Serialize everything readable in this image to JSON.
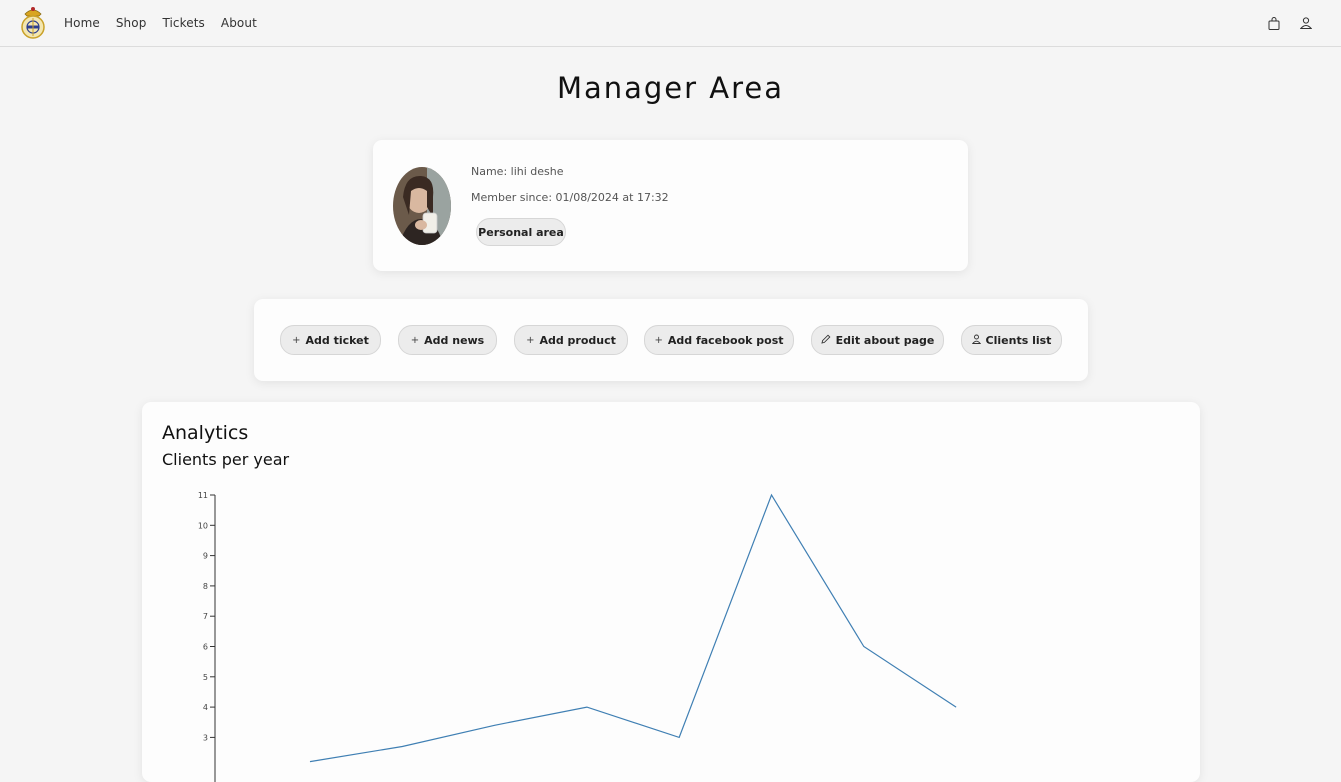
{
  "nav": {
    "links": [
      "Home",
      "Shop",
      "Tickets",
      "About"
    ],
    "icons": [
      "bag-icon",
      "user-icon"
    ],
    "logo": "club-crest-logo"
  },
  "page": {
    "title": "Manager Area"
  },
  "profile": {
    "name_line": "Name: lihi deshe",
    "member_since_line": "Member since: 01/08/2024 at 17:32",
    "personal_area_label": "Personal area"
  },
  "actions": [
    {
      "prefix": "+",
      "label": "Add ticket"
    },
    {
      "prefix": "+",
      "label": "Add news"
    },
    {
      "prefix": "+",
      "label": "Add product"
    },
    {
      "prefix": "+",
      "label": "Add facebook post"
    },
    {
      "prefix": "pencil-icon",
      "label": "Edit about page"
    },
    {
      "prefix": "user-icon",
      "label": "Clients list"
    }
  ],
  "analytics": {
    "title": "Analytics"
  },
  "colors": {
    "line": "#3f7fb3",
    "background": "#f5f5f5",
    "card": "#fdfdfd"
  },
  "chart_data": {
    "type": "line",
    "title": "Clients per year",
    "yticks": [
      3,
      4,
      5,
      6,
      7,
      8,
      9,
      10,
      11
    ],
    "ylim": [
      2,
      11
    ],
    "x_index": [
      0,
      1,
      2,
      3,
      4,
      5,
      6,
      7
    ],
    "values": [
      2.2,
      2.7,
      3.4,
      4,
      3,
      11,
      6,
      4
    ],
    "grid": false
  }
}
